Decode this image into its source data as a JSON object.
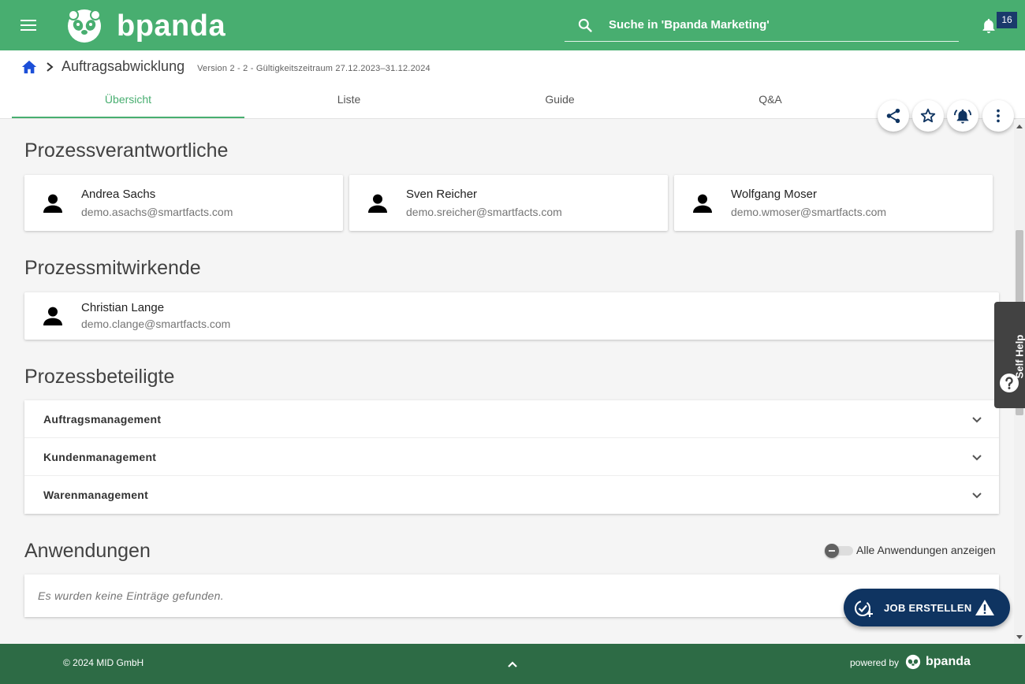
{
  "colors": {
    "brand_green": "#48ae70",
    "footer_green": "#2d6b45",
    "navy": "#0f3461",
    "badge": "#1a3a6b"
  },
  "topbar": {
    "logo_text": "bpanda",
    "search_placeholder": "Suche in 'Bpanda Marketing'",
    "notification_count": "16"
  },
  "header": {
    "title": "Auftragsabwicklung",
    "meta": "Version 2 - 2 - Gültigkeitszeitraum 27.12.2023–31.12.2024",
    "tabs": [
      {
        "label": "Übersicht",
        "active": true
      },
      {
        "label": "Liste"
      },
      {
        "label": "Guide"
      },
      {
        "label": "Q&A"
      }
    ],
    "actions": [
      "share-icon",
      "star-icon",
      "bell-icon",
      "more-vert-icon"
    ]
  },
  "sections": {
    "owners": {
      "title": "Prozessverantwortliche",
      "people": [
        {
          "name": "Andrea Sachs",
          "email": "demo.asachs@smartfacts.com"
        },
        {
          "name": "Sven Reicher",
          "email": "demo.sreicher@smartfacts.com"
        },
        {
          "name": "Wolfgang Moser",
          "email": "demo.wmoser@smartfacts.com"
        }
      ]
    },
    "contributors": {
      "title": "Prozessmitwirkende",
      "people": [
        {
          "name": "Christian Lange",
          "email": "demo.clange@smartfacts.com"
        }
      ]
    },
    "participants": {
      "title": "Prozessbeteiligte",
      "items": [
        {
          "label": "Auftragsmanagement"
        },
        {
          "label": "Kundenmanagement"
        },
        {
          "label": "Warenmanagement"
        }
      ]
    },
    "applications": {
      "title": "Anwendungen",
      "toggle_label": "Alle Anwendungen anzeigen",
      "empty_text": "Es wurden keine Einträge gefunden."
    }
  },
  "job_button": {
    "label": "JOB ERSTELLEN"
  },
  "self_help": {
    "label": "Self Help"
  },
  "footer": {
    "copyright": "© 2024 MID GmbH",
    "powered_by": "powered by",
    "logo_text": "bpanda"
  }
}
